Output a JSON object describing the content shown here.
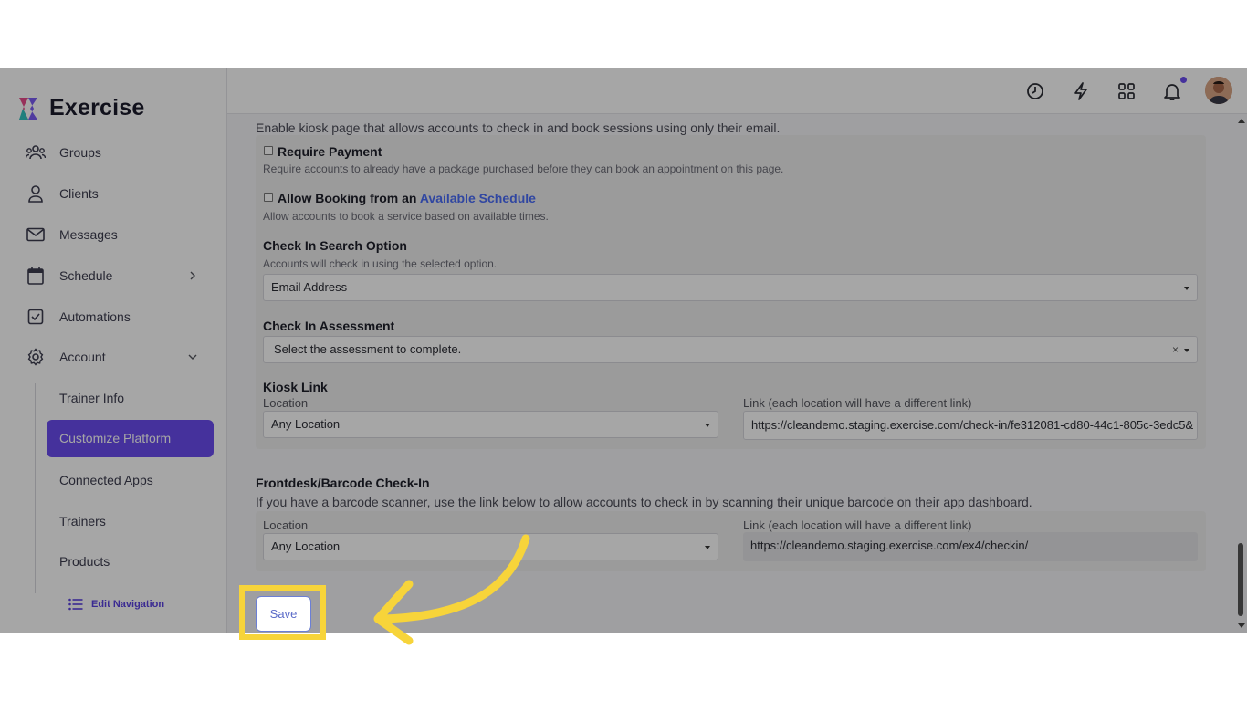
{
  "app": {
    "brand": "Exercise"
  },
  "sidebar": {
    "items": [
      {
        "label": "Groups",
        "icon": "groups-icon"
      },
      {
        "label": "Clients",
        "icon": "user-icon"
      },
      {
        "label": "Messages",
        "icon": "mail-icon"
      },
      {
        "label": "Schedule",
        "icon": "calendar-icon"
      },
      {
        "label": "Automations",
        "icon": "checkbox-icon"
      },
      {
        "label": "Account",
        "icon": "gear-icon"
      }
    ],
    "sub_items": [
      {
        "label": "Trainer Info"
      },
      {
        "label": "Customize Platform",
        "active": true
      },
      {
        "label": "Connected Apps"
      },
      {
        "label": "Trainers"
      },
      {
        "label": "Products"
      }
    ],
    "edit_nav": "Edit Navigation"
  },
  "topbar": {
    "icons": [
      "clock-icon",
      "bolt-icon",
      "grid-icon",
      "bell-icon"
    ]
  },
  "kiosk": {
    "description": "Enable kiosk page that allows accounts to check in and book sessions using only their email.",
    "require_payment": {
      "label": "Require Payment",
      "hint": "Require accounts to already have a package purchased before they can book an appointment on this page."
    },
    "allow_booking": {
      "label_prefix": "Allow Booking from an",
      "label_link": "Available Schedule",
      "hint": "Allow accounts to book a service based on available times."
    },
    "search_option": {
      "label": "Check In Search Option",
      "hint": "Accounts will check in using the selected option.",
      "value": "Email Address"
    },
    "assessment": {
      "label": "Check In Assessment",
      "placeholder": "Select the assessment to complete.",
      "clear": "×"
    },
    "link": {
      "label": "Kiosk Link",
      "location_label": "Location",
      "location_value": "Any Location",
      "link_label": "Link (each location will have a different link)",
      "link_value": "https://cleandemo.staging.exercise.com/check-in/fe312081-cd80-44c1-805c-3edc5&"
    }
  },
  "frontdesk": {
    "title": "Frontdesk/Barcode Check-In",
    "description": "If you have a barcode scanner, use the link below to allow accounts to check in by scanning their unique barcode on their app dashboard.",
    "location_label": "Location",
    "location_value": "Any Location",
    "link_label": "Link (each location will have a different link)",
    "link_value": "https://cleandemo.staging.exercise.com/ex4/checkin/"
  },
  "actions": {
    "save_label": "Save"
  },
  "colors": {
    "accent": "#6a4cf0",
    "highlight": "#f7d43a",
    "link": "#4a6cf7"
  }
}
